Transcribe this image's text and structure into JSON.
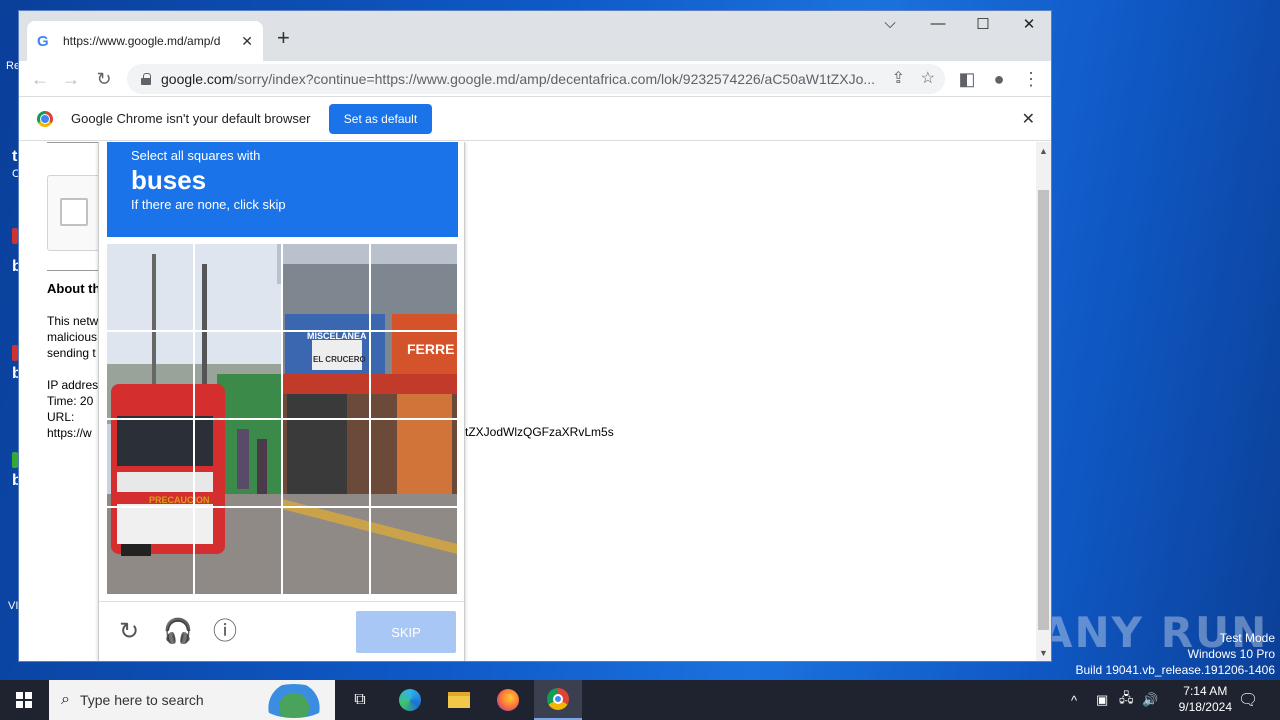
{
  "browser": {
    "tab_title": "https://www.google.md/amp/d",
    "url_domain": "google.com",
    "url_rest": "/sorry/index?continue=https://www.google.md/amp/decentafrica.com/lok/9232574226/aC50aW1tZXJo...",
    "infobar_message": "Google Chrome isn't your default browser",
    "set_default_label": "Set as default"
  },
  "sorry_page": {
    "about_heading": "About th",
    "para_lines": [
      "This netw",
      "malicious",
      "sending t"
    ],
    "ip_label": "IP addres",
    "time_label": "Time: 20",
    "url_label": "URL:",
    "url_value_start": "https://w",
    "url_value_tail": "tZXJodWlzQGFzaXRvLm5s"
  },
  "captcha": {
    "instruction": "Select all squares with",
    "target": "buses",
    "hint": "If there are none, click skip",
    "skip_label": "SKIP",
    "scene_texts": [
      "MISCELANEA",
      "EL CRUCERO",
      "FERRE",
      "PRECAUCION"
    ]
  },
  "taskbar": {
    "search_placeholder": "Type here to search",
    "time": "7:14 AM",
    "date": "9/18/2024"
  },
  "watermark": {
    "line1": "Test Mode",
    "line2": "Windows 10 Pro",
    "line3": "Build 19041.vb_release.191206-1406",
    "brand": "ANY RUN"
  },
  "desktop": {
    "left_fragments": [
      "Re",
      "t",
      "C",
      "b",
      "b",
      "b",
      "VI"
    ]
  },
  "colors": {
    "captcha_blue": "#1a73e8",
    "skip_disabled": "#a8c7f5",
    "desktop_blue": "#0f5ac8"
  }
}
